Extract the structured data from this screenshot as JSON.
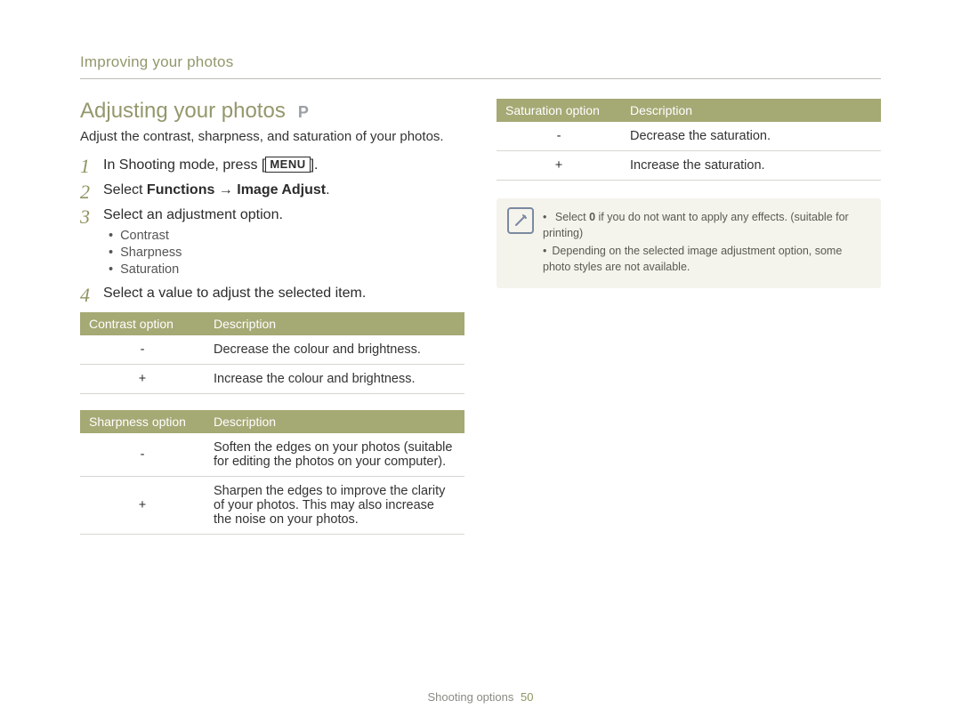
{
  "chapter": "Improving your photos",
  "heading": "Adjusting your photos",
  "mode_badge": "P",
  "lead": "Adjust the contrast, sharpness, and saturation of your photos.",
  "steps": {
    "s1_pre": "In Shooting mode, press [",
    "s1_kbd": "MENU",
    "s1_post": "].",
    "s2_pre": "Select ",
    "s2_bold": "Functions → Image Adjust",
    "s2_post": ".",
    "s3": "Select an adjustment option.",
    "s3_sub": [
      "Contrast",
      "Sharpness",
      "Saturation"
    ],
    "s4": "Select a value to adjust the selected item."
  },
  "tables": {
    "contrast": {
      "headers": [
        "Contrast option",
        "Description"
      ],
      "rows": [
        {
          "opt": "-",
          "desc": "Decrease the colour and brightness."
        },
        {
          "opt": "+",
          "desc": "Increase the colour and brightness."
        }
      ]
    },
    "sharpness": {
      "headers": [
        "Sharpness option",
        "Description"
      ],
      "rows": [
        {
          "opt": "-",
          "desc": "Soften the edges on your photos (suitable for editing the photos on your computer)."
        },
        {
          "opt": "+",
          "desc": "Sharpen the edges to improve the clarity of your photos. This may also increase the noise on your photos."
        }
      ]
    },
    "saturation": {
      "headers": [
        "Saturation option",
        "Description"
      ],
      "rows": [
        {
          "opt": "-",
          "desc": "Decrease the saturation."
        },
        {
          "opt": "+",
          "desc": "Increase the saturation."
        }
      ]
    }
  },
  "note": {
    "line1_pre": "Select ",
    "line1_bold": "0",
    "line1_post": " if you do not want to apply any effects. (suitable for printing)",
    "line2": "Depending on the selected image adjustment option, some photo styles are not available."
  },
  "footer": {
    "section": "Shooting options",
    "page": "50"
  }
}
